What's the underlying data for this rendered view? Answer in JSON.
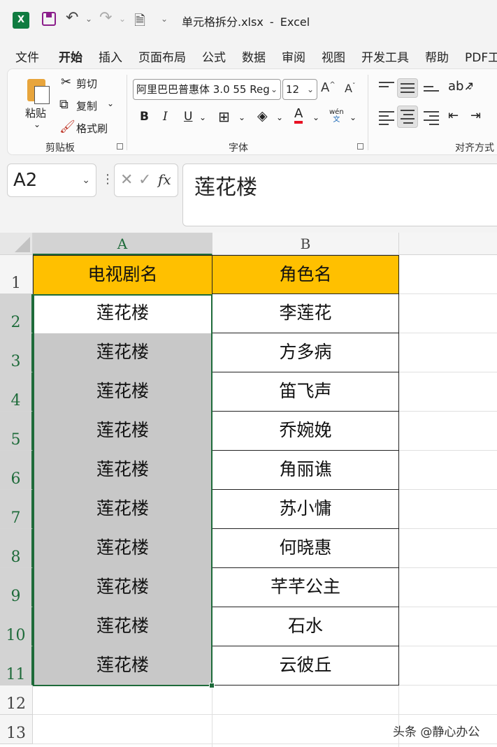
{
  "titlebar": {
    "app_icon": "excel-icon",
    "filename": "单元格拆分.xlsx",
    "separator": "-",
    "app_name": "Excel"
  },
  "menu": [
    "文件",
    "开始",
    "插入",
    "页面布局",
    "公式",
    "数据",
    "审阅",
    "视图",
    "开发工具",
    "帮助",
    "PDF工"
  ],
  "active_menu": "开始",
  "ribbon": {
    "clipboard": {
      "paste": "粘贴",
      "cut": "剪切",
      "copy": "复制",
      "format_painter": "格式刷",
      "label": "剪贴板"
    },
    "font": {
      "font_name": "阿里巴巴普惠体 3.0 55 Regu",
      "font_size": "12",
      "bold": "B",
      "italic": "I",
      "underline": "U",
      "font_color_letter": "A",
      "phonetic": "wén",
      "phonetic_char": "文",
      "label": "字体"
    },
    "alignment": {
      "label": "对齐方式"
    }
  },
  "formula_bar": {
    "name_box": "A2",
    "content": "莲花楼",
    "fx": "fx"
  },
  "columns": [
    "A",
    "B"
  ],
  "rows": [
    "1",
    "2",
    "3",
    "4",
    "5",
    "6",
    "7",
    "8",
    "9",
    "10",
    "11",
    "12",
    "13"
  ],
  "table": {
    "headers": [
      "电视剧名",
      "角色名"
    ],
    "col_a": [
      "莲花楼",
      "莲花楼",
      "莲花楼",
      "莲花楼",
      "莲花楼",
      "莲花楼",
      "莲花楼",
      "莲花楼",
      "莲花楼",
      "莲花楼"
    ],
    "col_b": [
      "李莲花",
      "方多病",
      "笛飞声",
      "乔婉娩",
      "角丽谯",
      "苏小慵",
      "何晓惠",
      "芊芊公主",
      "石水",
      "云彼丘"
    ]
  },
  "colors": {
    "header_fill": "#ffc000",
    "selected_fill": "#c8c8c8",
    "accent": "#107c41"
  },
  "watermark": "头条 @静心办公"
}
